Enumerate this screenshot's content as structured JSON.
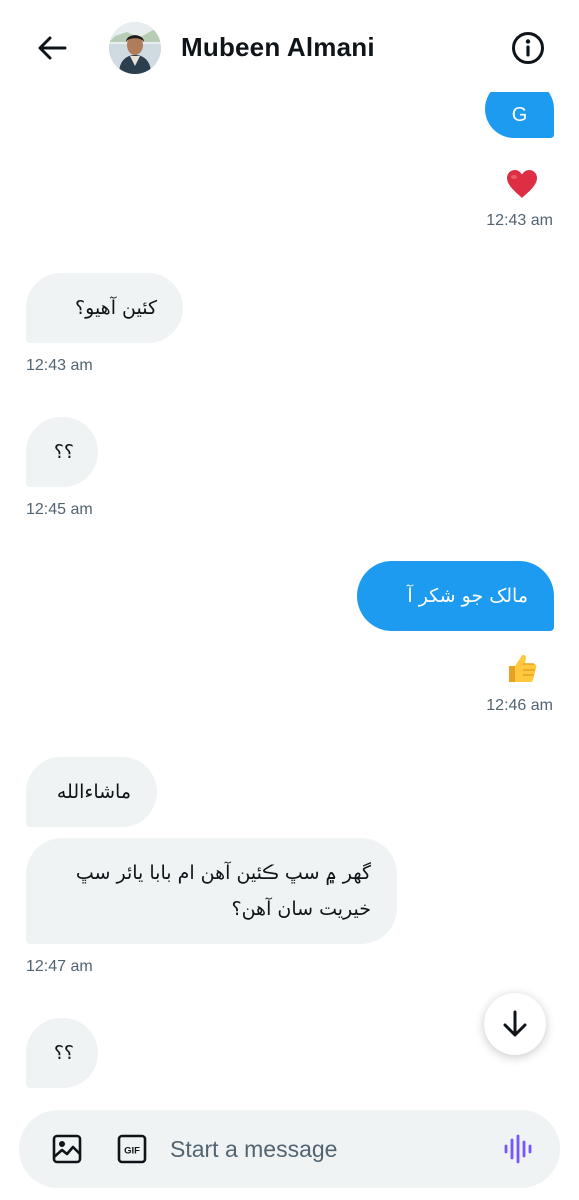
{
  "header": {
    "contact_name": "Mubeen Almani",
    "icons": {
      "back": "arrow-left-icon",
      "info": "info-icon",
      "avatar": "avatar-photo"
    }
  },
  "messages": [
    {
      "direction": "outgoing",
      "text": "G",
      "reaction": "red-heart",
      "time": "12:43 am"
    },
    {
      "direction": "incoming",
      "text": "کئين آهيو؟",
      "time": "12:43 am"
    },
    {
      "direction": "incoming",
      "text": "؟؟",
      "time": "12:45 am"
    },
    {
      "direction": "outgoing",
      "text": "مالک جو شکر آ",
      "reaction": "thumbs-up",
      "time": "12:46 am"
    },
    {
      "direction": "incoming",
      "text": "ماشاءالله"
    },
    {
      "direction": "incoming",
      "text": "گهر ۾ سڀ ڪئين آهن ام بابا يائر سڀ خيريت سان آهن؟",
      "time": "12:47 am"
    },
    {
      "direction": "incoming",
      "text": "؟؟"
    }
  ],
  "composer": {
    "placeholder": "Start a message",
    "gif_label": "GIF",
    "icons": {
      "image": "image-icon",
      "gif": "gif-icon",
      "voice": "voice-wave-icon"
    }
  },
  "colors": {
    "outgoing_bubble": "#1d9bf0",
    "incoming_bubble": "#eff3f4",
    "timestamp": "#536471",
    "voice_icon": "#7856ff"
  }
}
